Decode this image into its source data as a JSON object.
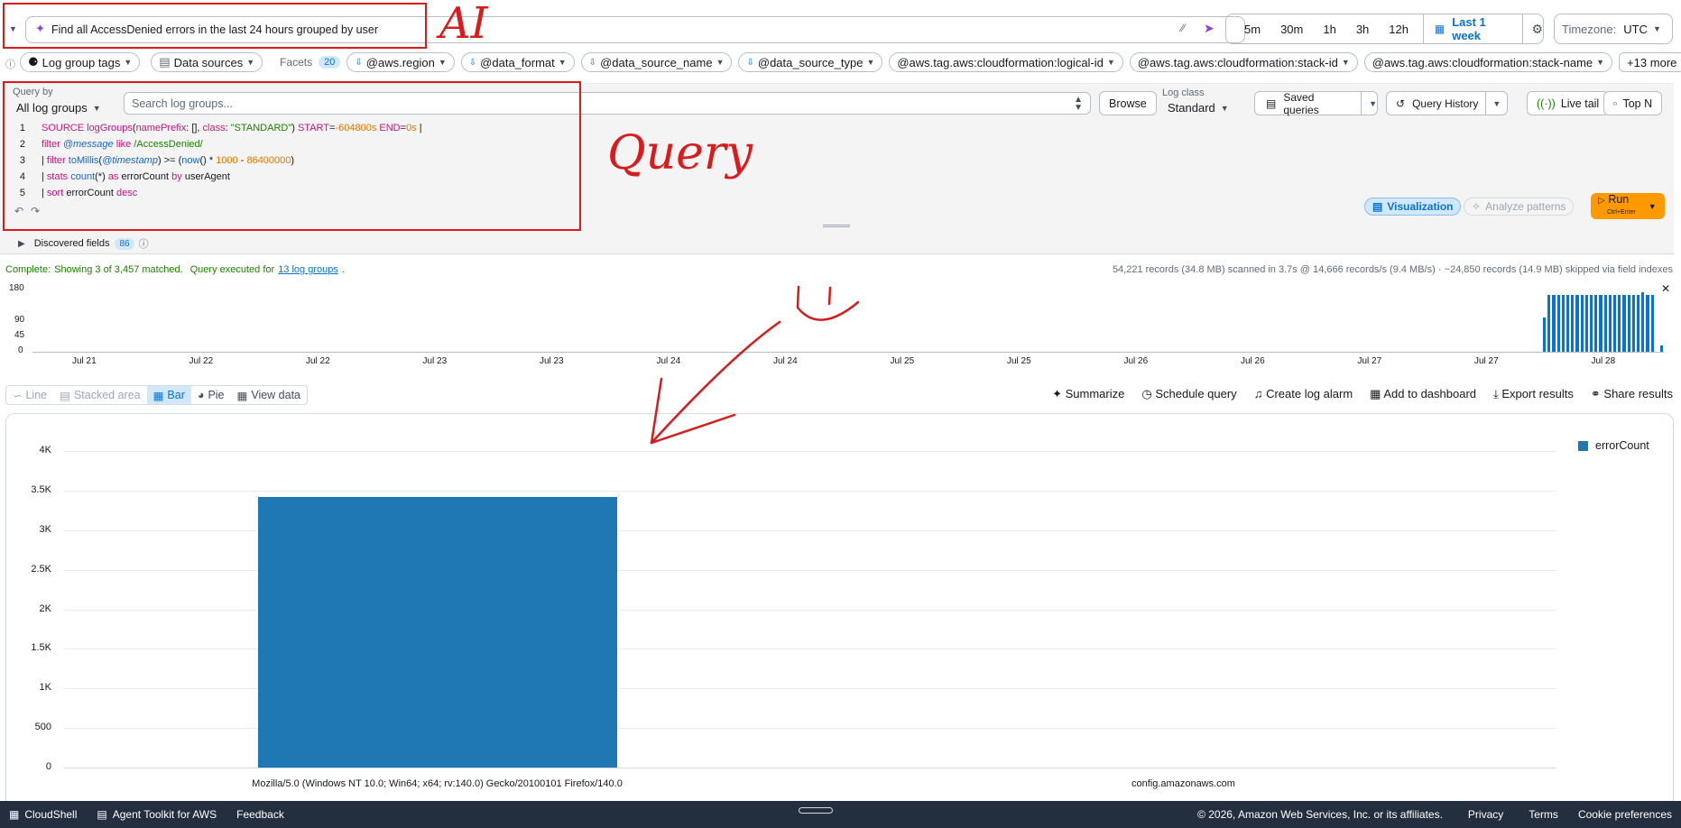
{
  "ai_bar": {
    "prompt": "Find all AccessDenied errors in the last 24 hours grouped by user"
  },
  "time_range": {
    "options": [
      "5m",
      "30m",
      "1h",
      "3h",
      "12h"
    ],
    "selected": "Last 1 week",
    "timezone_label": "Timezone:",
    "timezone": "UTC"
  },
  "facets_bar": {
    "log_group_tags": "Log group tags",
    "data_sources": "Data sources",
    "facets_label": "Facets",
    "facets_count": "20",
    "fields": [
      "@aws.region",
      "@data_format",
      "@data_source_name",
      "@data_source_type",
      "@aws.tag.aws:cloudformation:logical-id",
      "@aws.tag.aws:cloudformation:stack-id",
      "@aws.tag.aws:cloudformation:stack-name"
    ],
    "more": "+13 more"
  },
  "query_bar": {
    "query_by_label": "Query by",
    "query_by_value": "All log groups",
    "search_placeholder": "Search log groups...",
    "browse": "Browse",
    "log_class_label": "Log class",
    "log_class_value": "Standard",
    "saved_queries": "Saved queries",
    "query_history": "Query History",
    "live_tail": "Live tail",
    "top_n": "Top N"
  },
  "editor": {
    "line_numbers": [
      "1",
      "2",
      "3",
      "4",
      "5"
    ],
    "visualization": "Visualization",
    "analyze_patterns": "Analyze patterns",
    "run": "Run",
    "run_shortcut": "Ctrl+Enter"
  },
  "discovered": {
    "label": "Discovered fields",
    "count": "86"
  },
  "status": {
    "complete": "Complete:",
    "showing": "Showing 3 of 3,457 matched.",
    "executed": "Query executed for",
    "log_groups_link": "13 log groups",
    "stats": "54,221 records (34.8 MB) scanned in 3.7s @ 14,666 records/s (9.4 MB/s) · ~24,850 records (14.9 MB) skipped via field indexes"
  },
  "histogram": {
    "y_ticks": [
      "180",
      "90",
      "45",
      "0"
    ],
    "x_ticks": [
      "Jul 21",
      "Jul 22",
      "Jul 22",
      "Jul 23",
      "Jul 23",
      "Jul 24",
      "Jul 24",
      "Jul 25",
      "Jul 25",
      "Jul 26",
      "Jul 26",
      "Jul 27",
      "Jul 27",
      "Jul 28"
    ],
    "bars": [
      0.55,
      0.9,
      0.9,
      0.9,
      0.9,
      0.9,
      0.9,
      0.9,
      0.9,
      0.9,
      0.9,
      0.9,
      0.9,
      0.9,
      0.9,
      0.9,
      0.9,
      0.9,
      0.9,
      0.9,
      0.9,
      0.95,
      0.9,
      0.9,
      0.1
    ]
  },
  "view_tabs": {
    "line": "Line",
    "stacked_area": "Stacked area",
    "bar": "Bar",
    "pie": "Pie",
    "view_data": "View data"
  },
  "actions": {
    "summarize": "Summarize",
    "schedule_query": "Schedule query",
    "create_log_alarm": "Create log alarm",
    "add_to_dashboard": "Add to dashboard",
    "export_results": "Export results",
    "share_results": "Share results"
  },
  "chart_data": {
    "type": "bar",
    "categories": [
      "Mozilla/5.0 (Windows NT 10.0; Win64; x64; rv:140.0) Gecko/20100101 Firefox/140.0",
      "config.amazonaws.com"
    ],
    "series": [
      {
        "name": "errorCount",
        "values": [
          3420,
          0
        ]
      }
    ],
    "y_ticks": [
      "4K",
      "3.5K",
      "3K",
      "2.5K",
      "2K",
      "1.5K",
      "1K",
      "500",
      "0"
    ],
    "ylim": [
      0,
      4000
    ],
    "legend": "top-right",
    "color": "#1f77b4",
    "grid": true
  },
  "annotations": {
    "ai": "AI",
    "query": "Query",
    "smiley": "⌣"
  },
  "footer": {
    "cloudshell": "CloudShell",
    "agent_toolkit": "Agent Toolkit for AWS",
    "feedback": "Feedback",
    "copyright": "© 2026, Amazon Web Services, Inc. or its affiliates.",
    "privacy": "Privacy",
    "terms": "Terms",
    "cookies": "Cookie preferences"
  }
}
